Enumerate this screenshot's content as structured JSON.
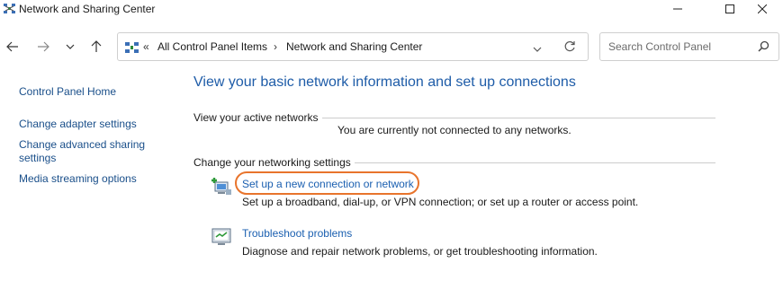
{
  "window": {
    "title": "Network and Sharing Center",
    "icon": "network-sharing-icon",
    "controls": [
      "minimize-icon",
      "maximize-icon",
      "close-icon"
    ]
  },
  "nav": {
    "back_icon": "arrow-left-icon",
    "forward_icon": "arrow-right-icon",
    "history_icon": "chevron-down-icon",
    "up_icon": "arrow-up-icon"
  },
  "address": {
    "overflow": "«",
    "breadcrumbs": [
      "All Control Panel Items",
      "Network and Sharing Center"
    ],
    "separator": "›",
    "dropdown_icon": "chevron-down-icon",
    "refresh_icon": "refresh-icon"
  },
  "search": {
    "placeholder": "Search Control Panel",
    "icon": "search-icon"
  },
  "sidebar": {
    "items": [
      {
        "label": "Control Panel Home"
      },
      {
        "label": "Change adapter settings"
      },
      {
        "label": "Change advanced sharing settings"
      },
      {
        "label": "Media streaming options"
      }
    ]
  },
  "main": {
    "heading": "View your basic network information and set up connections",
    "active_networks": {
      "title": "View your active networks",
      "status": "You are currently not connected to any networks."
    },
    "networking_settings": {
      "title": "Change your networking settings",
      "tasks": [
        {
          "label": "Set up a new connection or network",
          "description": "Set up a broadband, dial-up, or VPN connection; or set up a router or access point.",
          "icon": "new-connection-icon",
          "highlighted": true,
          "highlight_color": "#e8742c"
        },
        {
          "label": "Troubleshoot problems",
          "description": "Diagnose and repair network problems, or get troubleshooting information.",
          "icon": "troubleshoot-icon"
        }
      ]
    }
  },
  "colors": {
    "link": "#1a5fb0",
    "heading": "#1e5ca8",
    "sidebar_link": "#1a4f8a"
  }
}
